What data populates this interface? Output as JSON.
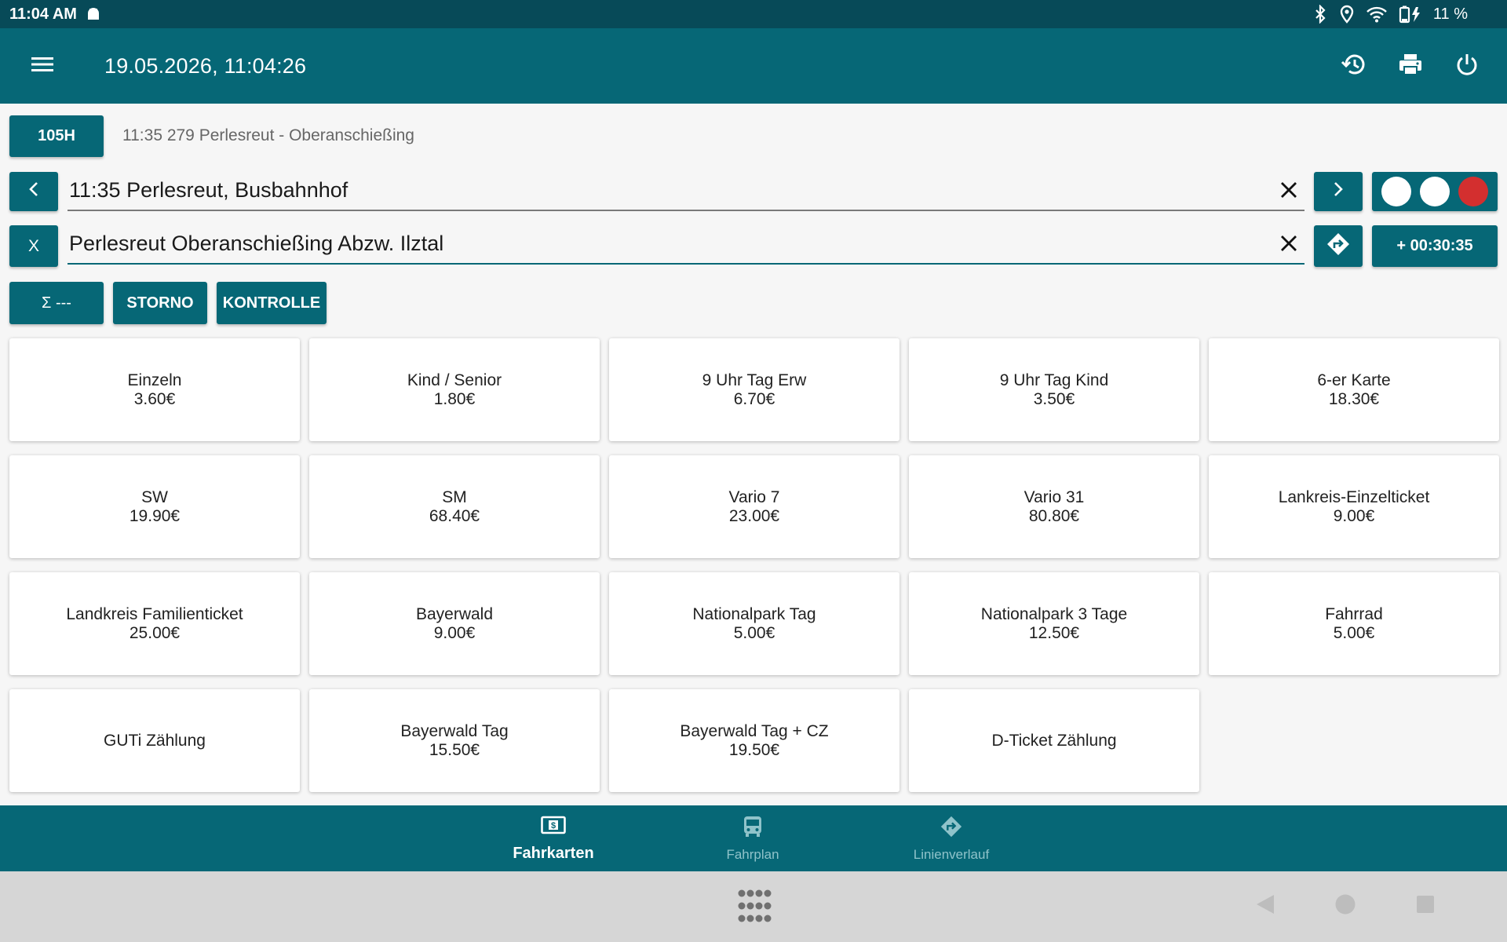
{
  "status_bar": {
    "time": "11:04 AM",
    "battery": "11 %"
  },
  "app_bar": {
    "datetime": "19.05.2026, 11:04:26"
  },
  "line": {
    "code": "105H",
    "info": "11:35 279 Perlesreut - Oberanschießing"
  },
  "from": {
    "prev_label": "<",
    "value": "11:35 Perlesreut, Busbahnhof",
    "next_label": ">"
  },
  "to": {
    "x_label": "X",
    "value": "Perlesreut Oberanschießing Abzw. Ilztal",
    "duration": "+ 00:30:35"
  },
  "actions": {
    "sum": "Σ ---",
    "storno": "STORNO",
    "kontrolle": "KONTROLLE"
  },
  "tickets": [
    {
      "name": "Einzeln",
      "price": "3.60€"
    },
    {
      "name": "Kind / Senior",
      "price": "1.80€"
    },
    {
      "name": "9 Uhr Tag Erw",
      "price": "6.70€"
    },
    {
      "name": "9 Uhr Tag Kind",
      "price": "3.50€"
    },
    {
      "name": "6-er Karte",
      "price": "18.30€"
    },
    {
      "name": "SW",
      "price": "19.90€"
    },
    {
      "name": "SM",
      "price": "68.40€"
    },
    {
      "name": "Vario 7",
      "price": "23.00€"
    },
    {
      "name": "Vario 31",
      "price": "80.80€"
    },
    {
      "name": "Lankreis-Einzelticket",
      "price": "9.00€"
    },
    {
      "name": "Landkreis Familienticket",
      "price": "25.00€"
    },
    {
      "name": "Bayerwald",
      "price": "9.00€"
    },
    {
      "name": "Nationalpark Tag",
      "price": "5.00€"
    },
    {
      "name": "Nationalpark 3 Tage",
      "price": "12.50€"
    },
    {
      "name": "Fahrrad",
      "price": "5.00€"
    },
    {
      "name": "GUTi Zählung",
      "price": ""
    },
    {
      "name": "Bayerwald Tag",
      "price": "15.50€"
    },
    {
      "name": "Bayerwald Tag + CZ",
      "price": "19.50€"
    },
    {
      "name": "D-Ticket Zählung",
      "price": ""
    }
  ],
  "bottom_nav": {
    "tickets": "Fahrkarten",
    "timetable": "Fahrplan",
    "route": "Linienverlauf"
  },
  "colors": {
    "primary": "#066776",
    "status_bar": "#074a58",
    "indicator_red": "#d32f2f"
  }
}
